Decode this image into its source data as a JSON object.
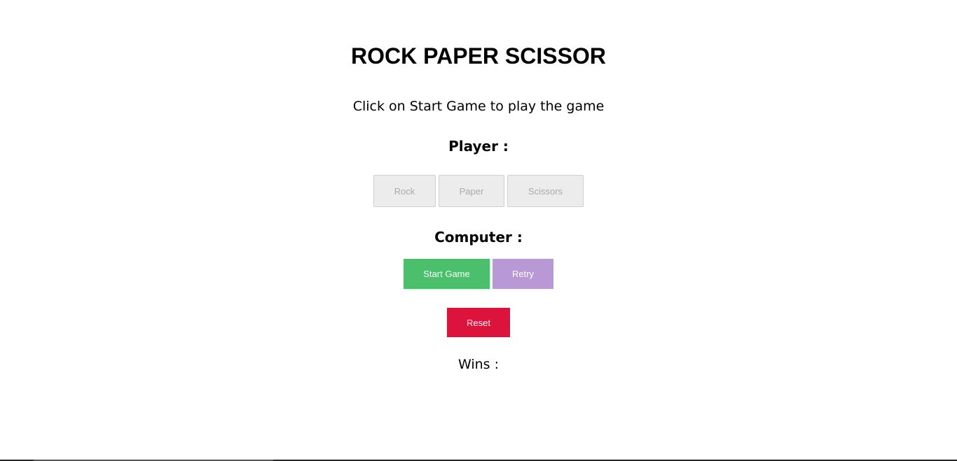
{
  "title": "ROCK PAPER SCISSOR",
  "instruction": "Click on Start Game to play the game",
  "player_label": "Player :",
  "player_buttons": {
    "rock": "Rock",
    "paper": "Paper",
    "scissors": "Scissors"
  },
  "computer_label": "Computer :",
  "controls": {
    "start": "Start Game",
    "retry": "Retry",
    "reset": "Reset"
  },
  "wins_label": "Wins :",
  "colors": {
    "start": "#4bbf6c",
    "retry": "#b898d5",
    "reset": "#dc143c"
  }
}
